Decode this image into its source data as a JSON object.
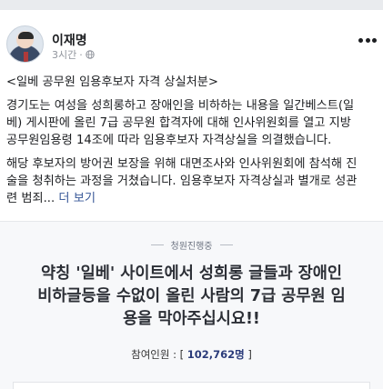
{
  "post": {
    "author": "이재명",
    "time": "3시간",
    "separator": "·",
    "title": "<일베 공무원 임용후보자 자격 상실처분>",
    "paragraph1": [
      "경기도는 여성을 성희롱하고 장애인을 비하하는 내용을 일간베스트(일",
      "베) 게시판에 올린 7급 공무원 합격자에 대해 인사위원회를 열고 지방",
      "공무원임용령 14조에 따라 임용후보자 자격상실을 의결했습니다."
    ],
    "paragraph2": [
      "해당 후보자의 방어권 보장을 위해 대면조사와 인사위원회에 참석해 진",
      "술을 청취하는 과정을 거쳤습니다. 임용후보자 자격상실과 별개로 성관"
    ],
    "paragraph2_tail": "련 범죄...",
    "see_more": "더 보기"
  },
  "petition": {
    "status": "청원진행중",
    "title_lines": [
      "약칭 '일베' 사이트에서 성희롱 글들과 장애인",
      "비하글등을 수없이 올린 사람의 7급 공무원 임",
      "용을 막아주십시요!!"
    ],
    "participants_label": "참여인원 : [",
    "participants_count": "102,762명",
    "participants_close": "]"
  },
  "icons": {
    "privacy": "globe-icon",
    "menu": "more-options-icon"
  },
  "colors": {
    "link": "#385898",
    "meta": "#90949c",
    "count": "#2a3b7a"
  }
}
